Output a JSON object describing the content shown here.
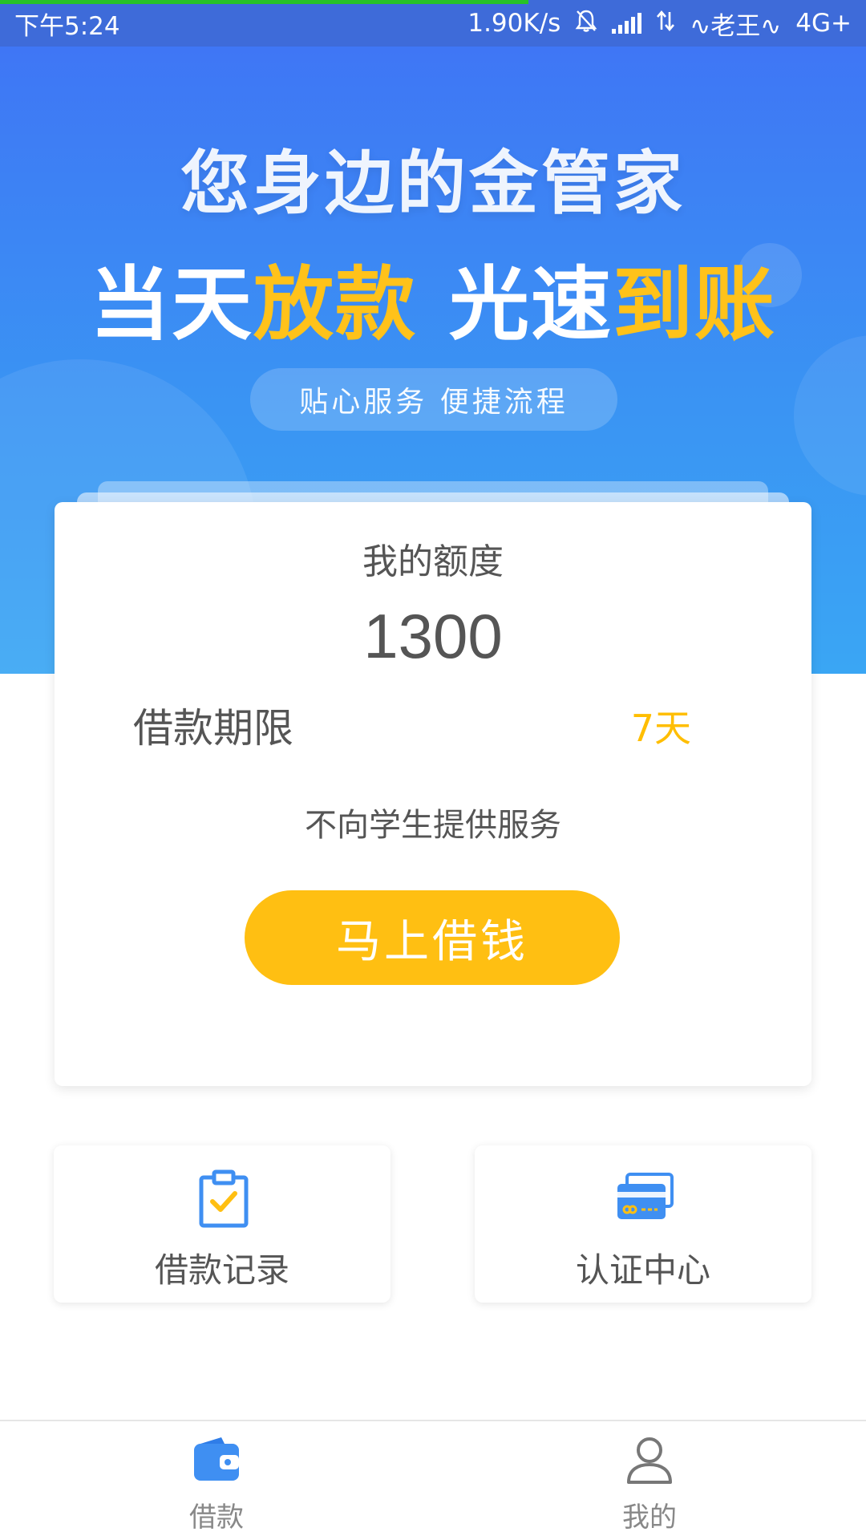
{
  "status_bar": {
    "time": "下午5:24",
    "speed": "1.90K/s",
    "carrier": "老王",
    "network": "4G+",
    "icons": [
      "notification-off-icon",
      "signal-icon",
      "data-transfer-icon",
      "carrier-decoration-icon"
    ],
    "progress": 0.61
  },
  "hero": {
    "title": "您身边的金管家",
    "slogan": {
      "part1_white": "当天",
      "part1_yellow": "放款",
      "part2_white": "光速",
      "part2_yellow": "到账"
    },
    "tagline": "贴心服务 便捷流程"
  },
  "quota_card": {
    "label": "我的额度",
    "amount": "1300",
    "term_label": "借款期限",
    "term_value": "7天",
    "notice": "不向学生提供服务",
    "button_label": "马上借钱"
  },
  "features": [
    {
      "label": "借款记录",
      "icon": "clipboard-check-icon"
    },
    {
      "label": "认证中心",
      "icon": "credit-card-icon"
    }
  ],
  "tab_bar": {
    "tabs": [
      {
        "label": "借款",
        "icon": "wallet-icon",
        "active": true
      },
      {
        "label": "我的",
        "icon": "user-icon",
        "active": false
      }
    ]
  },
  "colors": {
    "primary_blue": "#3f76f5",
    "accent_yellow": "#ffbf12",
    "text_gray": "#555555"
  }
}
